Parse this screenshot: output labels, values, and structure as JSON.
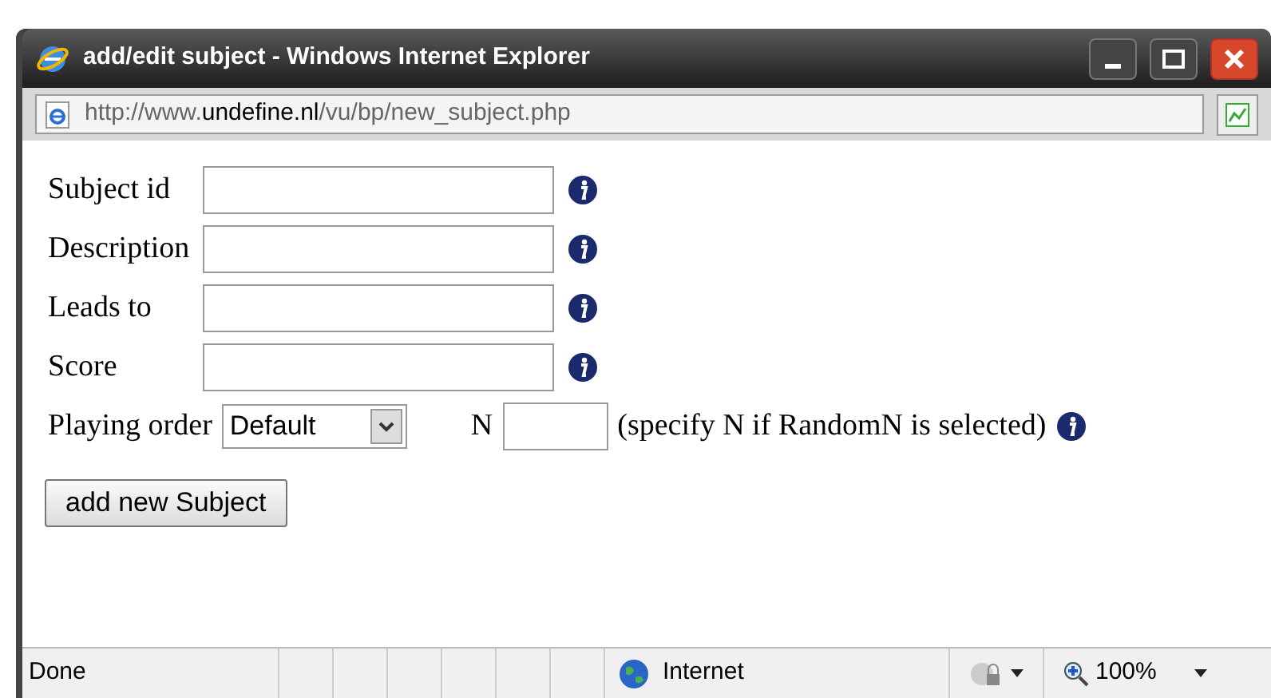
{
  "window": {
    "title": "add/edit subject - Windows Internet Explorer"
  },
  "address_bar": {
    "prefix": "http://www.",
    "domain": "undefine.nl",
    "path": "/vu/bp/new_subject.php"
  },
  "form": {
    "fields": [
      {
        "label": "Subject id"
      },
      {
        "label": "Description"
      },
      {
        "label": "Leads to"
      },
      {
        "label": "Score"
      }
    ],
    "playing_order": {
      "label": "Playing order",
      "value": "Default",
      "n_label": "N",
      "hint": "(specify N if RandomN is selected)"
    },
    "submit": "add new Subject"
  },
  "status_bar": {
    "status": "Done",
    "zone": "Internet",
    "zoom": "100%"
  }
}
